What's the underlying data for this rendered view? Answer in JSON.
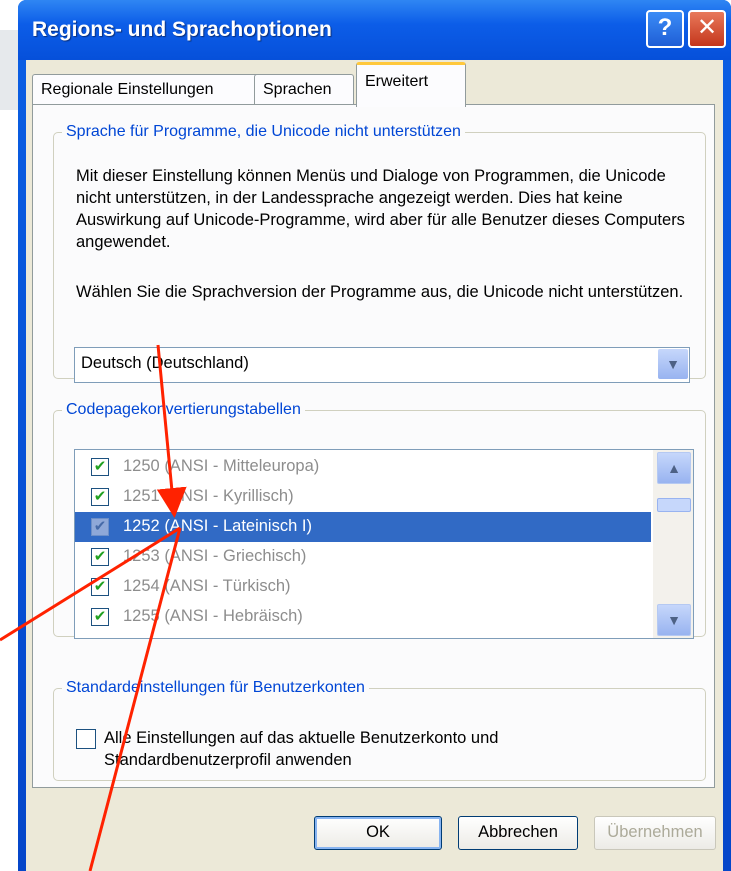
{
  "window": {
    "title": "Regions- und Sprachoptionen",
    "help_glyph": "?",
    "close_glyph": "✕"
  },
  "tabs": [
    {
      "label": "Regionale Einstellungen"
    },
    {
      "label": "Sprachen"
    },
    {
      "label": "Erweitert"
    }
  ],
  "group_unicode": {
    "legend": "Sprache für Programme, die Unicode nicht unterstützen",
    "description": "Mit dieser Einstellung können Menüs und Dialoge von Programmen, die Unicode nicht unterstützen, in der Landessprache angezeigt werden. Dies hat keine Auswirkung auf Unicode-Programme, wird aber für alle Benutzer dieses Computers angewendet.",
    "prompt": "Wählen Sie die Sprachversion der Programme aus, die Unicode nicht unterstützen.",
    "selected_language": "Deutsch (Deutschland)",
    "dropdown_glyph": "▼"
  },
  "group_codepages": {
    "legend": "Codepagekonvertierungstabellen",
    "items": [
      {
        "code": "1250",
        "name": "(ANSI - Mitteleuropa)",
        "checked": true,
        "selected": false,
        "glyph": "✔"
      },
      {
        "code": "1251",
        "name": "(ANSI - Kyrillisch)",
        "checked": true,
        "selected": false,
        "glyph": "✔"
      },
      {
        "code": "1252",
        "name": "(ANSI - Lateinisch I)",
        "checked": true,
        "selected": true,
        "glyph": "✔"
      },
      {
        "code": "1253",
        "name": "(ANSI - Griechisch)",
        "checked": true,
        "selected": false,
        "glyph": "✔"
      },
      {
        "code": "1254",
        "name": "(ANSI - Türkisch)",
        "checked": true,
        "selected": false,
        "glyph": "✔"
      },
      {
        "code": "1255",
        "name": "(ANSI - Hebräisch)",
        "checked": true,
        "selected": false,
        "glyph": "✔"
      }
    ],
    "scroll_up_glyph": "▲",
    "scroll_down_glyph": "▼"
  },
  "group_accounts": {
    "legend": "Standardeinstellungen für Benutzerkonten",
    "checkbox_label": "Alle Einstellungen auf das aktuelle Benutzerkonto und Standardbenutzerprofil anwenden",
    "checked": false
  },
  "buttons": {
    "ok": "OK",
    "cancel": "Abbrechen",
    "apply": "Übernehmen"
  },
  "colors": {
    "arrow": "#ff2200",
    "selection": "#316ac5",
    "legend": "#0046d5"
  }
}
